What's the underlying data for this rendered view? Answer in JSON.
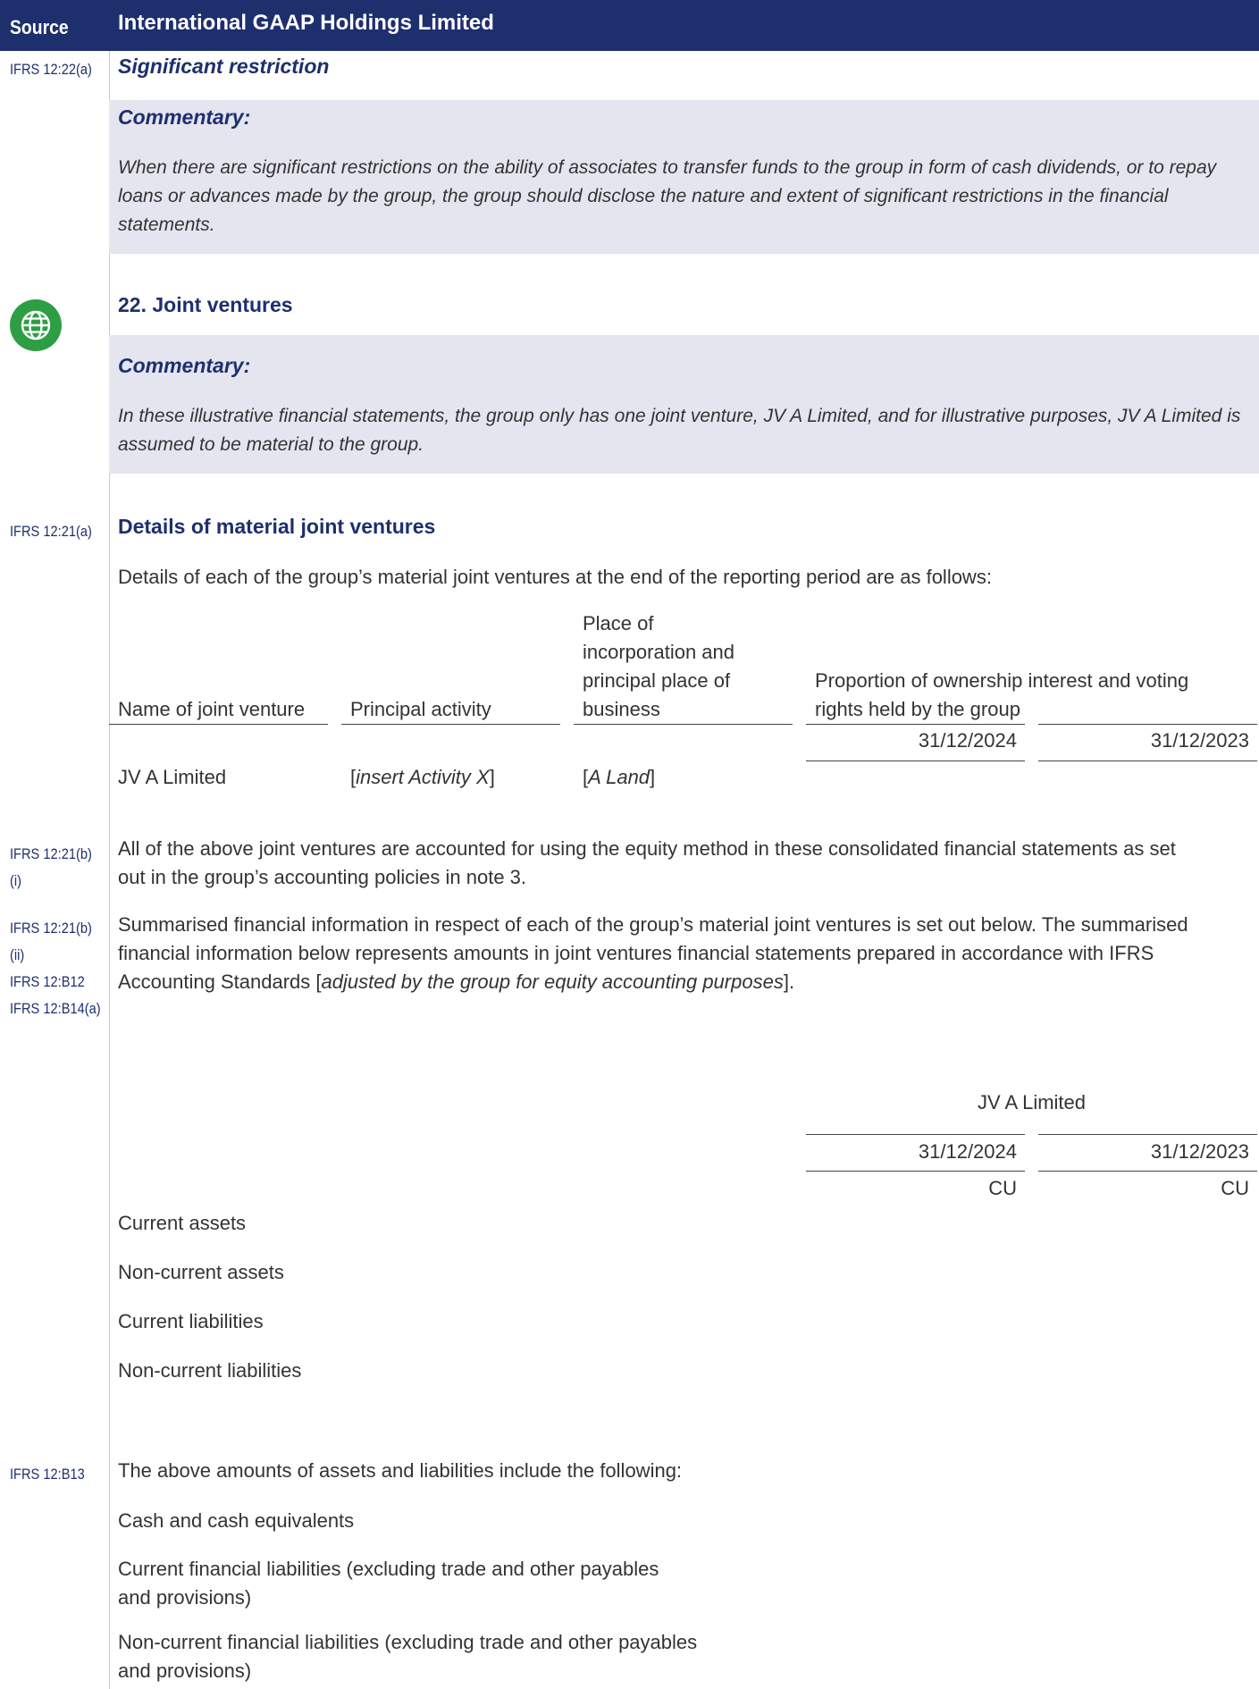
{
  "header": {
    "source_label": "Source",
    "title": "International GAAP Holdings Limited"
  },
  "section1": {
    "source_ref": "IFRS 12:22(a)",
    "heading": "Significant restriction",
    "commentary_label": "Commentary:",
    "commentary_lines": [
      "When there are significant restrictions on the ability of associates to transfer funds to the group in form of cash dividends, or to repay",
      "loans or advances made by the group, the group should disclose the nature and extent of significant restrictions in the financial",
      "statements."
    ]
  },
  "section2": {
    "icon": "globe-icon",
    "heading": "22. Joint ventures",
    "commentary_label": "Commentary:",
    "commentary_lines": [
      "In these illustrative financial statements, the group only has one joint venture, JV A Limited, and for illustrative purposes, JV A Limited is",
      "assumed to be material to the group."
    ]
  },
  "section3": {
    "source_ref": "IFRS 12:21(a)",
    "heading": "Details of material joint ventures",
    "intro": "Details of each of the group’s material joint ventures at the end of the reporting period are as follows:",
    "table": {
      "col_name": "Name of joint venture",
      "col_activity": "Principal activity",
      "col_place_lines": [
        "Place of",
        "incorporation and",
        "principal place of",
        "business"
      ],
      "col_prop_lines": [
        "Proportion of ownership interest and voting",
        "rights held by the group"
      ],
      "date_current": "31/12/2024",
      "date_prior": "31/12/2023",
      "row": {
        "name": "JV A Limited",
        "activity_open": "[",
        "activity_italic": "insert Activity X",
        "activity_close": "]",
        "place_open": "[",
        "place_italic": "A Land",
        "place_close": "]"
      }
    }
  },
  "section4": {
    "source_ref_line1": "IFRS 12:21(b)",
    "source_ref_line2": "(i)",
    "text_lines": [
      "All of the above joint ventures are accounted for using the equity method in these consolidated financial statements as set",
      "out in the group’s accounting policies in note 3."
    ]
  },
  "section5": {
    "source_refs": [
      "IFRS 12:21(b)",
      "(ii)",
      "IFRS 12:B12",
      "IFRS 12:B14(a)"
    ],
    "text_line1": "Summarised financial information in respect of each of the group’s material joint ventures is set out below. The summarised",
    "text_line2": "financial information below represents amounts in joint ventures financial statements prepared in accordance with IFRS",
    "text_line3_prefix": "Accounting Standards [",
    "text_line3_italic": "adjusted by the group for equity accounting purposes",
    "text_line3_suffix": "]."
  },
  "summary_table": {
    "entity": "JV A Limited",
    "date_current": "31/12/2024",
    "date_prior": "31/12/2023",
    "unit_current": "CU",
    "unit_prior": "CU",
    "rows": [
      "Current assets",
      "Non-current assets",
      "Current liabilities",
      "Non-current liabilities"
    ]
  },
  "section6": {
    "source_ref": "IFRS 12:B13",
    "intro": "The above amounts of assets and liabilities include the following:",
    "row1": "Cash and cash equivalents",
    "row2_lines": [
      "Current financial liabilities (excluding trade and other payables",
      "and provisions)"
    ],
    "row3_lines": [
      "Non-current financial liabilities (excluding trade and other payables",
      "and provisions)"
    ]
  }
}
